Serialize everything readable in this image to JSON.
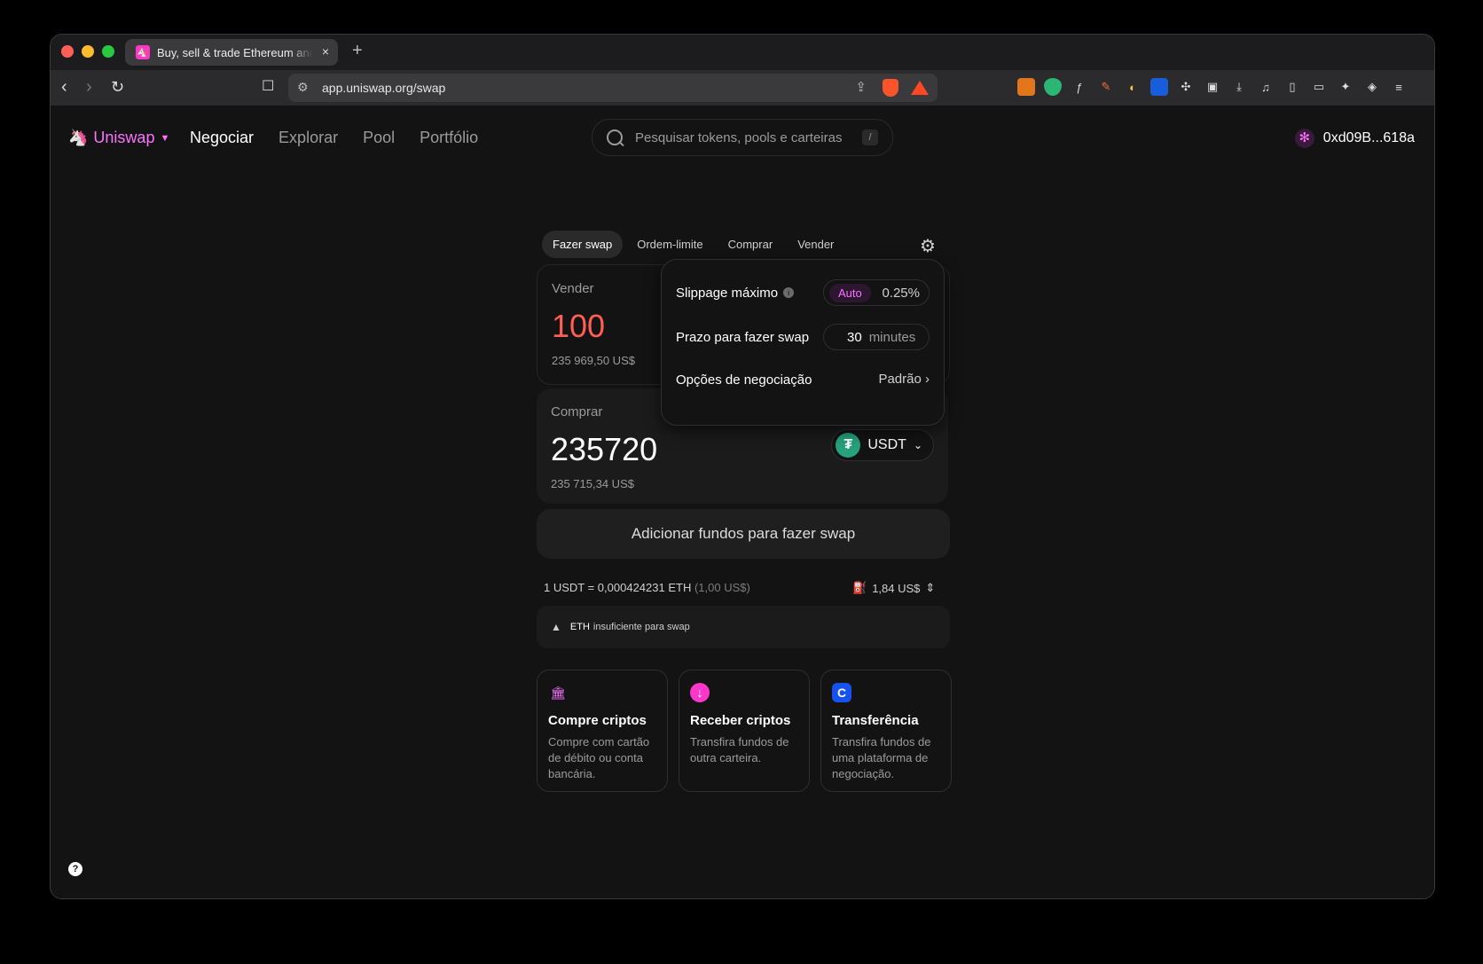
{
  "browser": {
    "tab_title": "Buy, sell & trade Ethereum and",
    "url": "app.uniswap.org/swap",
    "new_tab": "+",
    "close_tab": "×"
  },
  "header": {
    "logo": "Uniswap",
    "nav": [
      "Negociar",
      "Explorar",
      "Pool",
      "Portfólio"
    ],
    "search_placeholder": "Pesquisar tokens, pools e carteiras",
    "search_shortcut": "/",
    "account": "0xd09B...618a"
  },
  "swap": {
    "tabs": [
      "Fazer swap",
      "Ordem-limite",
      "Comprar",
      "Vender"
    ],
    "sell_label": "Vender",
    "sell_amount": "100",
    "sell_usd": "235 969,50 US$",
    "buy_label": "Comprar",
    "buy_amount": "235720",
    "buy_usd": "235 715,34 US$",
    "buy_token": "USDT",
    "add_funds": "Adicionar fundos para fazer swap",
    "rate_main": "1 USDT = 0,000424231 ETH",
    "rate_usd": "(1,00 US$)",
    "gas": "1,84 US$",
    "warning_token": "ETH",
    "warning_text": "insuficiente para swap"
  },
  "settings": {
    "slippage_label": "Slippage máximo",
    "slippage_mode": "Auto",
    "slippage_value": "0.25%",
    "deadline_label": "Prazo para fazer swap",
    "deadline_value": "30",
    "deadline_unit": "minutes",
    "trade_options_label": "Opções de negociação",
    "trade_options_value": "Padrão"
  },
  "tiles": [
    {
      "title": "Compre criptos",
      "desc": "Compre com cartão de débito ou conta bancária.",
      "color": "#fc72ff"
    },
    {
      "title": "Receber criptos",
      "desc": "Transfira fundos de outra carteira.",
      "color": "#fc37c9"
    },
    {
      "title": "Transferência",
      "desc": "Transfira fundos de uma plataforma de negociação.",
      "color": "#1652f0"
    }
  ],
  "colors": {
    "accent": "#fc72ff",
    "sell_amount": "#ff5f52",
    "background": "#131313"
  }
}
